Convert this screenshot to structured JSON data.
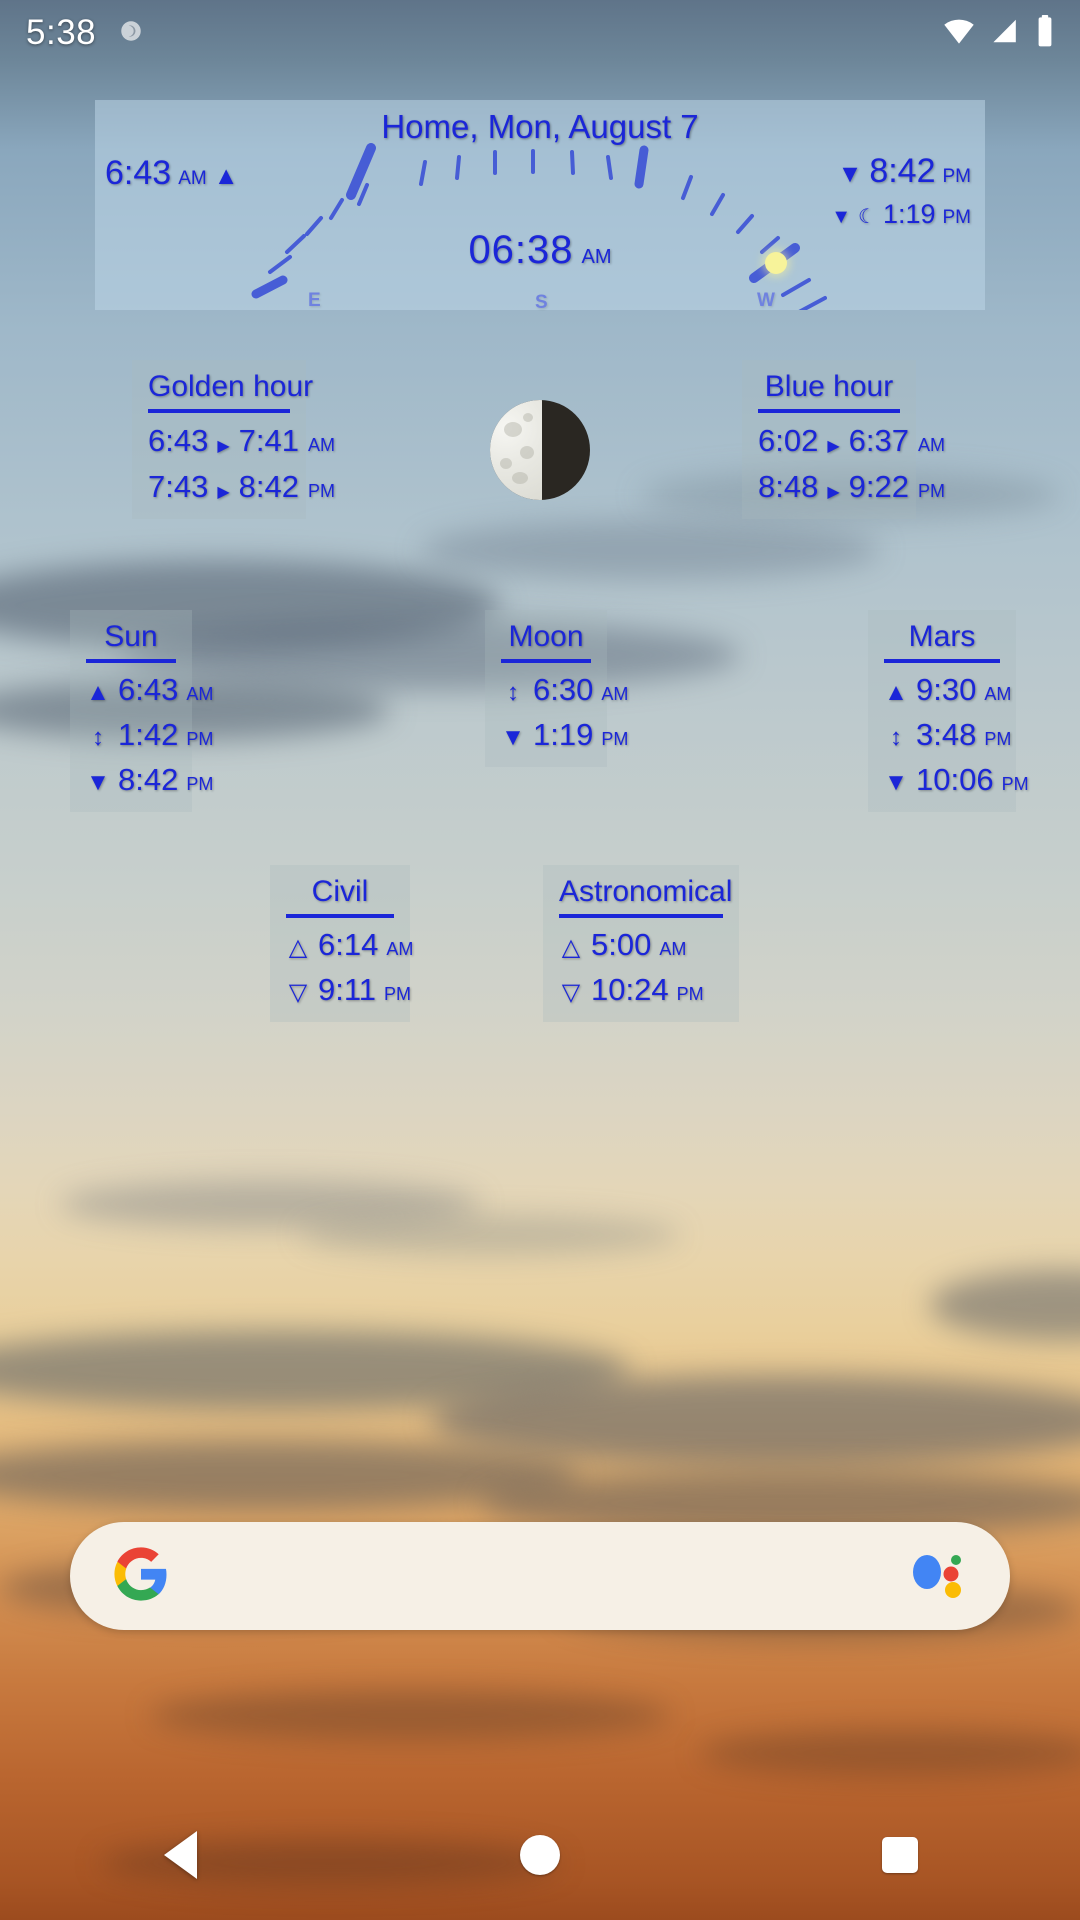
{
  "statusbar": {
    "clock": "5:38",
    "icons": [
      "dnd-moon-icon",
      "wifi-icon",
      "cell-signal-icon",
      "battery-icon"
    ]
  },
  "sun_dial": {
    "title": "Home, Mon, August 7",
    "sunrise": {
      "time": "6:43",
      "unit": "AM",
      "symbol": "▲"
    },
    "sunset": {
      "time": "8:42",
      "unit": "PM",
      "symbol": "▼"
    },
    "moonset": {
      "time": "1:19",
      "unit": "PM",
      "symbol": "▼",
      "moon_glyph": "☾"
    },
    "current_time": "06:38",
    "current_unit": "AM",
    "compass": {
      "east": "E",
      "south": "S",
      "west": "W"
    }
  },
  "golden_hour": {
    "title": "Golden hour",
    "ranges": [
      {
        "start": "6:43",
        "sep": "▶",
        "end": "7:41",
        "unit": "AM"
      },
      {
        "start": "7:43",
        "sep": "▶",
        "end": "8:42",
        "unit": "PM"
      }
    ]
  },
  "blue_hour": {
    "title": "Blue hour",
    "ranges": [
      {
        "start": "6:02",
        "sep": "▶",
        "end": "6:37",
        "unit": "AM"
      },
      {
        "start": "8:48",
        "sep": "▶",
        "end": "9:22",
        "unit": "PM"
      }
    ]
  },
  "sun_card": {
    "title": "Sun",
    "rows": [
      {
        "sym": "▲",
        "val": "6:43",
        "unit": "AM"
      },
      {
        "sym": "↕",
        "val": "1:42",
        "unit": "PM"
      },
      {
        "sym": "▼",
        "val": "8:42",
        "unit": "PM"
      }
    ]
  },
  "moon_card": {
    "title": "Moon",
    "rows": [
      {
        "sym": "↕",
        "val": "6:30",
        "unit": "AM"
      },
      {
        "sym": "▼",
        "val": "1:19",
        "unit": "PM"
      }
    ]
  },
  "mars_card": {
    "title": "Mars",
    "rows": [
      {
        "sym": "▲",
        "val": "9:30",
        "unit": "AM"
      },
      {
        "sym": "↕",
        "val": "3:48",
        "unit": "PM"
      },
      {
        "sym": "▼",
        "val": "10:06",
        "unit": "PM"
      }
    ]
  },
  "civil_card": {
    "title": "Civil",
    "rows": [
      {
        "sym": "△",
        "val": "6:14",
        "unit": "AM"
      },
      {
        "sym": "▽",
        "val": "9:11",
        "unit": "PM"
      }
    ]
  },
  "astronomical_card": {
    "title": "Astronomical",
    "rows": [
      {
        "sym": "△",
        "val": "5:00",
        "unit": "AM"
      },
      {
        "sym": "▽",
        "val": "10:24",
        "unit": "PM"
      }
    ]
  },
  "moon_phase": {
    "name": "last-quarter-moon-icon",
    "illuminated_side": "left"
  },
  "search_bar": {
    "google_logo": "google-g-icon",
    "assistant_icon": "google-assistant-icon",
    "placeholder": ""
  },
  "navbar": {
    "back": "back-button",
    "home": "home-button",
    "recents": "recents-button"
  },
  "colors": {
    "text_blue": "#1b26d8",
    "panel_fill": "rgba(190,214,232,0.52)",
    "card_fill": "rgba(170,185,190,0.30)",
    "sun_dot": "#f7f39a",
    "search_bg": "#f6f0e6"
  }
}
